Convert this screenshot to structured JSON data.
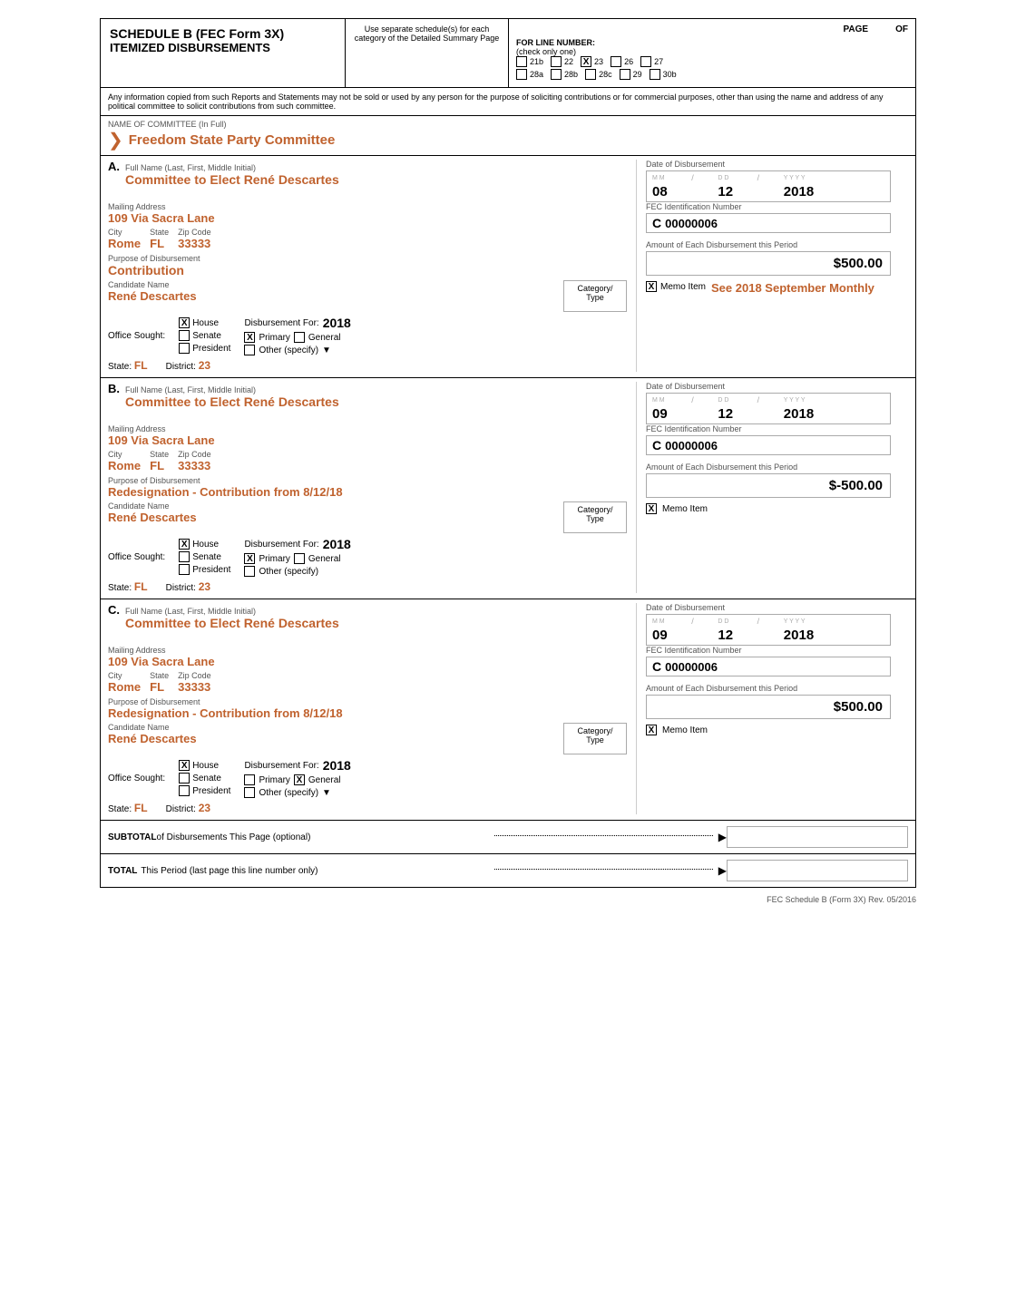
{
  "header": {
    "schedule_title": "SCHEDULE B  (FEC Form 3X)",
    "schedule_subtitle": "ITEMIZED DISBURSEMENTS",
    "use_separate_text": "Use separate schedule(s) for each category of the Detailed Summary Page",
    "for_line_number": "FOR LINE NUMBER:",
    "check_only_one": "(check only one)",
    "page_label": "PAGE",
    "of_label": "OF",
    "line_numbers": {
      "row1": [
        "21b",
        "22",
        "23",
        "26",
        "27"
      ],
      "row2": [
        "28a",
        "28b",
        "28c",
        "29",
        "30b"
      ],
      "checked": "23"
    }
  },
  "disclaimer": "Any information copied from such Reports and Statements may not be sold or used by any person for the purpose of soliciting contributions or for commercial purposes, other than using the name and address of any political committee to solicit contributions from such committee.",
  "committee_label": "NAME OF COMMITTEE (In Full)",
  "committee_name": "Freedom State Party Committee",
  "entries": [
    {
      "letter": "A",
      "full_name_label": "Full Name (Last, First, Middle Initial)",
      "name": "Committee to Elect René Descartes",
      "mailing_label": "Mailing Address",
      "address": "109 Via Sacra Lane",
      "city_label": "City",
      "city": "Rome",
      "state_label": "State",
      "state": "FL",
      "zip_label": "Zip Code",
      "zip": "33333",
      "date_label": "Date of Disbursement",
      "date_m": "08",
      "date_d": "12",
      "date_y": "2018",
      "fec_label": "FEC Identification Number",
      "fec_prefix": "C",
      "fec_number": "00000006",
      "purpose_label": "Purpose of Disbursement",
      "purpose": "Contribution",
      "candidate_label": "Candidate Name",
      "candidate": "René Descartes",
      "category_label": "Category/ Type",
      "office_label": "Office Sought:",
      "office_checked": "House",
      "offices": [
        "House",
        "Senate",
        "President"
      ],
      "disb_for_label": "Disbursement For:",
      "disb_for_year": "2018",
      "primary_label": "Primary",
      "general_label": "General",
      "other_label": "Other (specify)",
      "primary_checked": true,
      "general_checked": false,
      "state_label2": "State:",
      "state_value2": "FL",
      "district_label": "District:",
      "district_value": "23",
      "amount_label": "Amount of Each Disbursement this Period",
      "amount": "$500.00",
      "memo_item_checked": true,
      "memo_item_label": "Memo Item",
      "memo_text": "See 2018 September Monthly"
    },
    {
      "letter": "B",
      "full_name_label": "Full Name (Last, First, Middle Initial)",
      "name": "Committee to Elect René Descartes",
      "mailing_label": "Mailing Address",
      "address": "109 Via Sacra Lane",
      "city_label": "City",
      "city": "Rome",
      "state_label": "State",
      "state": "FL",
      "zip_label": "Zip Code",
      "zip": "33333",
      "date_label": "Date of Disbursement",
      "date_m": "09",
      "date_d": "12",
      "date_y": "2018",
      "fec_label": "FEC Identification Number",
      "fec_prefix": "C",
      "fec_number": "00000006",
      "purpose_label": "Purpose of Disbursement",
      "purpose": "Redesignation - Contribution from 8/12/18",
      "candidate_label": "Candidate Name",
      "candidate": "René Descartes",
      "category_label": "Category/ Type",
      "office_label": "Office Sought:",
      "office_checked": "House",
      "offices": [
        "House",
        "Senate",
        "President"
      ],
      "disb_for_label": "Disbursement For:",
      "disb_for_year": "2018",
      "primary_label": "Primary",
      "general_label": "General",
      "other_label": "Other (specify)",
      "primary_checked": true,
      "general_checked": false,
      "state_label2": "State:",
      "state_value2": "FL",
      "district_label": "District:",
      "district_value": "23",
      "amount_label": "Amount of Each Disbursement this Period",
      "amount": "$-500.00",
      "memo_item_checked": true,
      "memo_item_label": "Memo Item",
      "memo_text": ""
    },
    {
      "letter": "C",
      "full_name_label": "Full Name (Last, First, Middle Initial)",
      "name": "Committee to Elect René Descartes",
      "mailing_label": "Mailing Address",
      "address": "109 Via Sacra Lane",
      "city_label": "City",
      "city": "Rome",
      "state_label": "State",
      "state": "FL",
      "zip_label": "Zip Code",
      "zip": "33333",
      "date_label": "Date of Disbursement",
      "date_m": "09",
      "date_d": "12",
      "date_y": "2018",
      "fec_label": "FEC Identification Number",
      "fec_prefix": "C",
      "fec_number": "00000006",
      "purpose_label": "Purpose of Disbursement",
      "purpose": "Redesignation - Contribution from 8/12/18",
      "candidate_label": "Candidate Name",
      "candidate": "René Descartes",
      "category_label": "Category/ Type",
      "office_label": "Office Sought:",
      "office_checked": "House",
      "offices": [
        "House",
        "Senate",
        "President"
      ],
      "disb_for_label": "Disbursement For:",
      "disb_for_year": "2018",
      "primary_label": "Primary",
      "general_label": "General",
      "other_label": "Other (specify)",
      "primary_checked": false,
      "general_checked": true,
      "state_label2": "State:",
      "state_value2": "FL",
      "district_label": "District:",
      "district_value": "23",
      "amount_label": "Amount of Each Disbursement this Period",
      "amount": "$500.00",
      "memo_item_checked": true,
      "memo_item_label": "Memo Item",
      "memo_text": ""
    }
  ],
  "subtotal": {
    "label": "SUBTOTAL",
    "sublabel": "of Disbursements This Page (optional)",
    "arrow": "▶"
  },
  "total": {
    "label": "TOTAL",
    "sublabel": "This Period (last page this line number only)",
    "arrow": "▶"
  },
  "footer": "FEC Schedule B (Form 3X) Rev. 05/2016"
}
